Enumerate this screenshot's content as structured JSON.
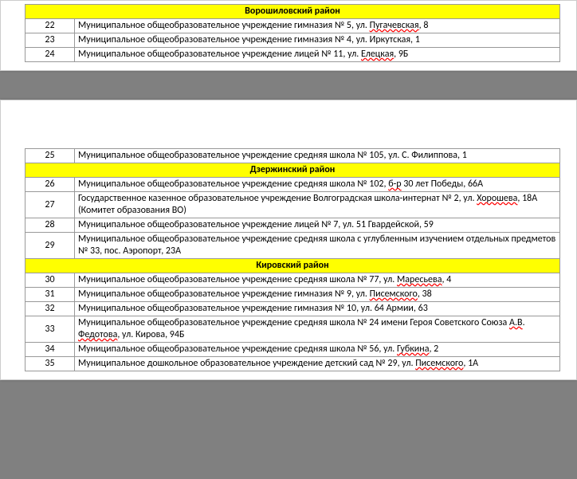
{
  "sections": {
    "voroshilovsky": {
      "title": "Ворошиловский район",
      "rows": [
        {
          "num": "22",
          "text_a": "Муниципальное общеобразовательное учреждение гимназия № 5, ул. ",
          "sq1": "Пугачевская",
          "text_b": ", 8"
        },
        {
          "num": "23",
          "text_a": "Муниципальное общеобразовательное учреждение гимназия № 4, ул. Иркутская, 1"
        },
        {
          "num": "24",
          "text_a": "Муниципальное общеобразовательное учреждение лицей № 11, ул. ",
          "sq1": "Елецкая",
          "text_b": ", 9Б"
        }
      ],
      "trailing": [
        {
          "num": "25",
          "text_a": "Муниципальное общеобразовательное учреждение средняя школа № 105, ул. С. Филиппова, 1"
        }
      ]
    },
    "dzerzhinsky": {
      "title": "Дзержинский район",
      "rows": [
        {
          "num": "26",
          "text_a": "Муниципальное общеобразовательное учреждение средняя школа № 102, ",
          "sq1": "б-р",
          "text_b": " 30 лет Победы, 66А"
        },
        {
          "num": "27",
          "text_a": "Государственное казенное образовательное учреждение Волгоградская школа-интернат № 2, ул. ",
          "sq1": "Хорошева",
          "text_b": ", 18А (Комитет образования ВО)"
        },
        {
          "num": "28",
          "text_a": "Муниципальное общеобразовательное учреждение лицей № 7, ул. 51 Гвардейской, 59"
        },
        {
          "num": "29",
          "text_a": "Муниципальное общеобразовательное учреждение средняя школа с углубленным изучением отдельных предметов  № 33, пос. Аэропорт, 23А"
        }
      ]
    },
    "kirovsky": {
      "title": "Кировский район",
      "rows": [
        {
          "num": "30",
          "text_a": "Муниципальное общеобразовательное учреждение средняя школа № 77, ул. ",
          "sq1": "Маресьева",
          "text_b": ", 4"
        },
        {
          "num": "31",
          "text_a": "Муниципальное общеобразовательное учреждение гимназия № 9, ул. ",
          "sq1": "Писемского",
          "text_b": ", 38"
        },
        {
          "num": "32",
          "text_a": "Муниципальное общеобразовательное учреждение гимназия № 10, ул. 64 Армии, 63"
        },
        {
          "num": "33",
          "text_a": "Муниципальное общеобразовательное учреждение средняя школа № 24 имени Героя Советского Союза ",
          "sq1": "А.В",
          "text_b": ". ",
          "sq2": "Федотова",
          "text_c": ", ул. Кирова, 94Б"
        },
        {
          "num": "34",
          "text_a": "Муниципальное общеобразовательное учреждение средняя школа № 56, ул. ",
          "sq1": "Губкина",
          "text_b": ", 2"
        },
        {
          "num": "35",
          "text_a": "Муниципальное дошкольное образовательное учреждение детский сад № 29, ул. ",
          "sq1": "Писемского",
          "text_b": ", 1А"
        }
      ]
    }
  }
}
